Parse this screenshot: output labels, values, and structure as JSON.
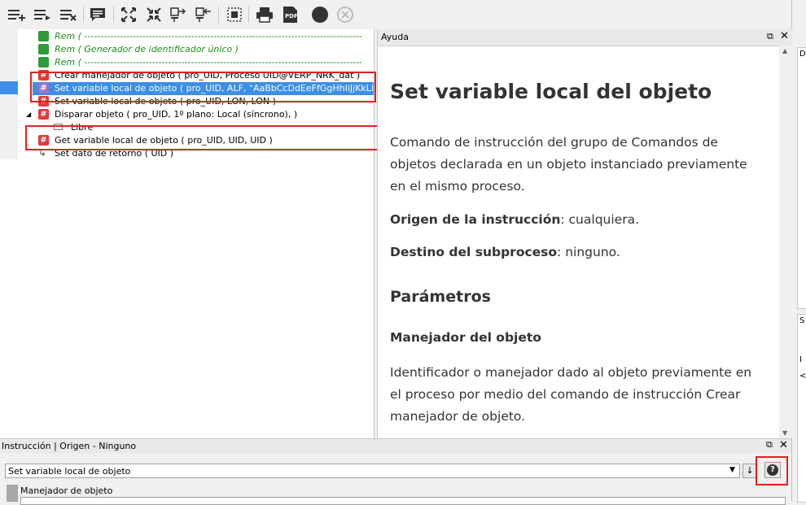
{
  "toolbar": {
    "buttons": [
      {
        "name": "insert-below-icon"
      },
      {
        "name": "insert-above-icon"
      },
      {
        "name": "delete-lines-icon"
      },
      {
        "name": "comment-icon"
      },
      {
        "name": "expand-icon"
      },
      {
        "name": "collapse-icon"
      },
      {
        "name": "move-right-icon"
      },
      {
        "name": "move-left-icon"
      },
      {
        "name": "select-block-icon"
      },
      {
        "name": "print-icon"
      },
      {
        "name": "pdf-icon"
      },
      {
        "name": "record-icon"
      },
      {
        "name": "cancel-circle-icon"
      }
    ],
    "pdf_label": "PDF"
  },
  "tree": {
    "rows": [
      {
        "kind": "rem",
        "text": "Rem ( --------------------------------------------------------------------------------------"
      },
      {
        "kind": "rem",
        "text": "Rem ( Generador de identificador único )"
      },
      {
        "kind": "rem",
        "text": "Rem ( --------------------------------------------------------------------------------------"
      },
      {
        "kind": "cmd",
        "text": "Crear manejador de objeto ( pro_UID, Proceso UID@VERP_NRK_dat )"
      },
      {
        "kind": "cmd",
        "text": "Set variable local de objeto ( pro_UID, ALF, \"AaBbCcDdEeFfGgHhIiJjKkLl...",
        "selected": true
      },
      {
        "kind": "cmd",
        "text": "Set variable local de objeto ( pro_UID, LON, LON )"
      },
      {
        "kind": "cmd",
        "text": "Disparar objeto ( pro_UID, 1º plano: Local (síncrono),  )"
      },
      {
        "kind": "free",
        "text": "Libre"
      },
      {
        "kind": "cmd",
        "text": "Get variable local de objeto ( pro_UID, UID, UID )"
      },
      {
        "kind": "ret",
        "text": "Set dato de retorno ( UID )"
      }
    ]
  },
  "help": {
    "header": "Ayuda",
    "title": "Set variable local del objeto",
    "intro": "Comando de instrucción del grupo de Comandos de objetos declarada en un objeto instanciado previamente en el mismo proceso.",
    "origin_label": "Origen de la instrucción",
    "origin_value": ": cualquiera.",
    "dest_label": "Destino del subproceso",
    "dest_value": ": ninguno.",
    "params_heading": "Parámetros",
    "param1_heading": "Manejador del objeto",
    "param1_text": "Identificador o manejador dado al objeto previamente en el proceso por medio del comando de instrucción Crear manejador de objeto."
  },
  "bottom": {
    "header": "Instrucción | Origen - Ninguno",
    "combo_value": "Set variable local de objeto",
    "field_label": "Manejador de objeto",
    "help_button": "?"
  },
  "right_strip": {
    "top_letter": "D",
    "mid_letter": "S",
    "lower_letter": "I",
    "arrow_glyph": "<"
  }
}
